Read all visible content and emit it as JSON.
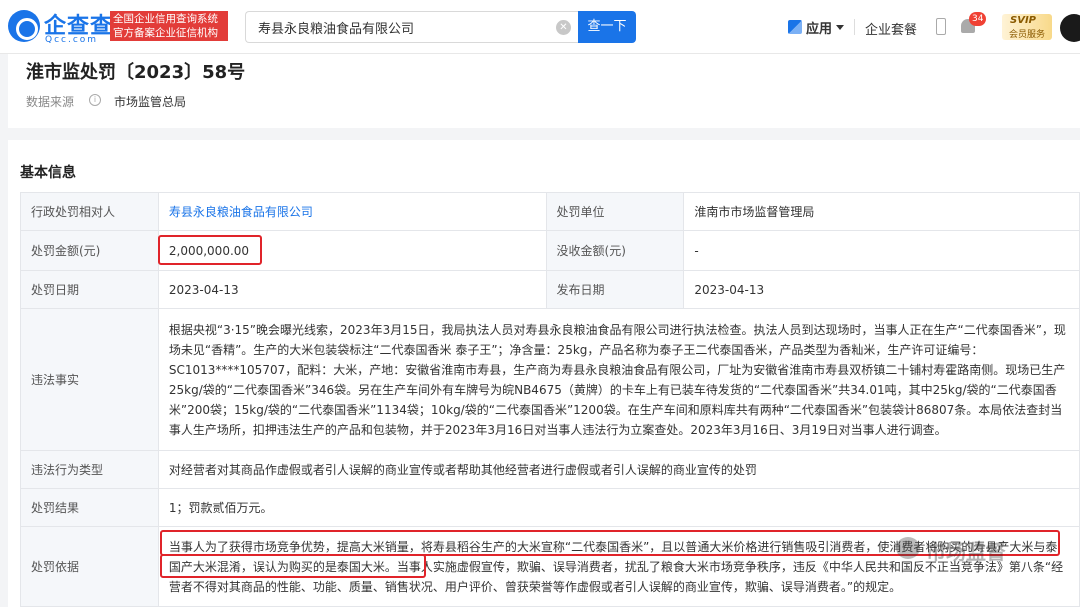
{
  "header": {
    "logo_text": "企查查",
    "logo_sub": "Qcc.com",
    "slogan_line1": "全国企业信用查询系统",
    "slogan_line2": "官方备案企业征信机构",
    "search_value": "寿县永良粮油食品有限公司",
    "search_button": "查一下",
    "app_menu": "应用",
    "enterprise_set": "企业套餐",
    "notification_count": "34",
    "vip_title": "SVIP",
    "vip_sub": "会员服务"
  },
  "record": {
    "title": "淮市监处罚〔2023〕58号",
    "source_label": "数据来源",
    "source_value": "市场监管总局"
  },
  "basic_info": {
    "section_title": "基本信息",
    "rows": {
      "party_label": "行政处罚相对人",
      "party_value": "寿县永良粮油食品有限公司",
      "unit_label": "处罚单位",
      "unit_value": "淮南市市场监督管理局",
      "amount_label": "处罚金额(元)",
      "amount_value": "2,000,000.00",
      "confiscate_label": "没收金额(元)",
      "confiscate_value": "-",
      "date_label": "处罚日期",
      "date_value": "2023-04-13",
      "publish_label": "发布日期",
      "publish_value": "2023-04-13",
      "facts_label": "违法事实",
      "facts_value": "根据央视“3·15”晚会曝光线索，2023年3月15日，我局执法人员对寿县永良粮油食品有限公司进行执法检查。执法人员到达现场时，当事人正在生产“二代泰国香米”，现场未见“香精”。生产的大米包装袋标注“二代泰国香米 泰子王”；净含量：25kg，产品名称为泰子王二代泰国香米，产品类型为香籼米，生产许可证编号：SC1013****105707，配料：大米，产地：安徽省淮南市寿县，生产商为寿县永良粮油食品有限公司，厂址为安徽省淮南市寿县双桥镇二十铺村寿霍路南侧。现场已生产25kg/袋的“二代泰国香米”346袋。另在生产车间外有车牌号为皖NB4675（黄牌）的卡车上有已装车待发货的“二代泰国香米”共34.01吨，其中25kg/袋的“二代泰国香米”200袋；15kg/袋的“二代泰国香米”1134袋；10kg/袋的“二代泰国香米”1200袋。在生产车间和原料库共有两种“二代泰国香米”包装袋计86807条。本局依法查封当事人生产场所，扣押违法生产的产品和包装物，并于2023年3月16日对当事人违法行为立案查处。2023年3月16日、3月19日对当事人进行调查。",
      "type_label": "违法行为类型",
      "type_value": "对经营者对其商品作虚假或者引人误解的商业宣传或者帮助其他经营者进行虚假或者引人误解的商业宣传的处罚",
      "result_label": "处罚结果",
      "result_value": "1；罚款贰佰万元。",
      "basis_label": "处罚依据",
      "basis_value": "当事人为了获得市场竞争优势，提高大米销量，将寿县稻谷生产的大米宣称“二代泰国香米”，且以普通大米价格进行销售吸引消费者，使消费者将购买的寿县产大米与泰国产大米混淆，误认为购买的是泰国大米。当事人实施虚假宣传，欺骗、误导消费者，扰乱了粮食大米市场竞争秩序，违反《中华人民共和国反不正当竞争法》第八条“经营者不得对其商品的性能、功能、质量、销售状况、用户评价、曾获荣誉等作虚假或者引人误解的商业宣传，欺骗、误导消费者。”的规定。"
    }
  },
  "watermark": "市场监督"
}
